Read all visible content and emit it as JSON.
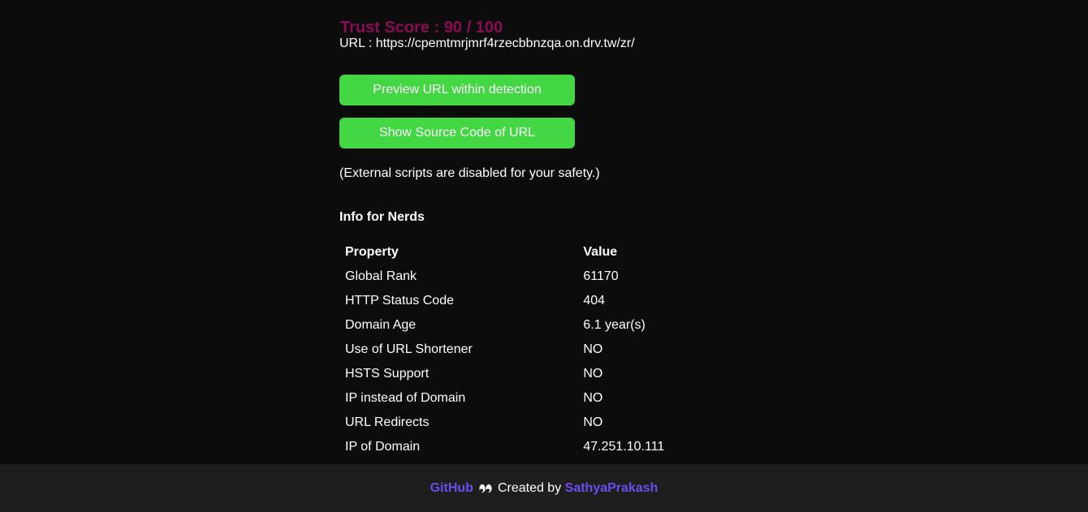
{
  "trust": {
    "label": "Trust Score : 90 / 100"
  },
  "url": {
    "label": "URL : https://cpemtmrjmrf4rzecbbnzqa.on.drv.tw/zr/"
  },
  "buttons": {
    "preview": "Preview URL within detection",
    "source": "Show Source Code of URL"
  },
  "note": "(External scripts are disabled for your safety.)",
  "nerds": {
    "heading": "Info for Nerds",
    "columns": [
      "Property",
      "Value"
    ],
    "rows": [
      [
        "Global Rank",
        "61170"
      ],
      [
        "HTTP Status Code",
        "404"
      ],
      [
        "Domain Age",
        "6.1 year(s)"
      ],
      [
        "Use of URL Shortener",
        "NO"
      ],
      [
        "HSTS Support",
        "NO"
      ],
      [
        "IP instead of Domain",
        "NO"
      ],
      [
        "URL Redirects",
        "NO"
      ],
      [
        "IP of Domain",
        "47.251.10.111"
      ]
    ]
  },
  "footer": {
    "github": "GitHub",
    "created_by": "Created by",
    "author": "SathyaPrakash",
    "icon": "eyes-icon"
  },
  "colors": {
    "background": "#0c0c0d",
    "trust_score": "#8b0b53",
    "button": "#43d843",
    "footer_bg": "#1e1e1e",
    "link": "#6d4cf0"
  }
}
